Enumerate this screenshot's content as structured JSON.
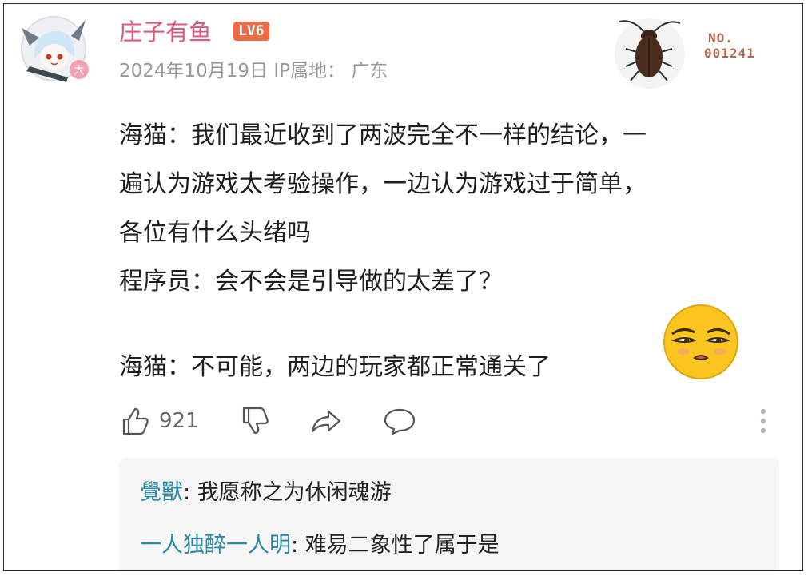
{
  "user": {
    "name": "庄子有鱼",
    "level": "LV6",
    "date": "2024年10月19日",
    "ip_label": "IP属地：",
    "location": "广东",
    "avatar_badge": "大"
  },
  "decoration": {
    "number_prefix": "NO.",
    "number": "001241"
  },
  "post": {
    "lines": [
      "海猫：我们最近收到了两波完全不一样的结论，一",
      "遍认为游戏太考验操作，一边认为游戏过于简单，",
      "各位有什么头绪吗",
      "程序员：会不会是引导做的太差了？",
      "海猫：不可能，两边的玩家都正常通关了"
    ]
  },
  "actions": {
    "like_count": "921",
    "icons": [
      "thumbs-up-icon",
      "thumbs-down-icon",
      "share-icon",
      "comment-icon",
      "more-vertical-icon"
    ]
  },
  "replies": [
    {
      "author": "覺獸",
      "separator": ": ",
      "text": "我愿称之为休闲魂游"
    },
    {
      "author": "一人独醉一人明",
      "separator": ": ",
      "text": "难易二象性了属于是"
    }
  ],
  "colors": {
    "username": "#e0577b",
    "level_badge": "#ef6a42",
    "reply_author": "#2b8aa8",
    "meta": "#999999"
  }
}
